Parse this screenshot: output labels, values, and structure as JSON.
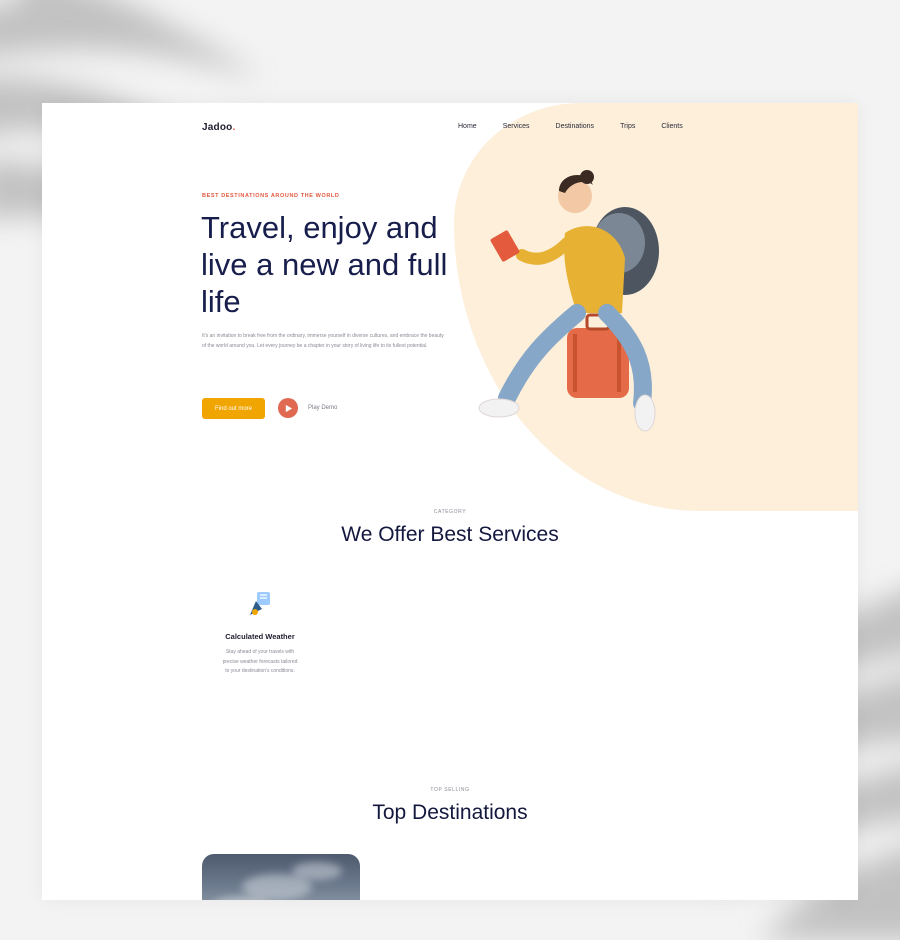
{
  "brand": {
    "name": "Jadoo",
    "suffix": "."
  },
  "nav": {
    "items": [
      "Home",
      "Services",
      "Destinations",
      "Trips",
      "Clients"
    ]
  },
  "hero": {
    "eyebrow": "Best destinations around the world",
    "title": "Travel, enjoy and live a new and full life",
    "description": "It's an invitation to break free from the ordinary, immerse yourself in diverse cultures, and embrace the beauty of the world around you. Let every journey be a chapter in your story of living life to its fullest potential.",
    "cta_label": "Find out more",
    "play_label": "Play Demo"
  },
  "services": {
    "eyebrow": "CATEGORY",
    "title": "We Offer Best Services",
    "items": [
      {
        "title": "Calculated Weather",
        "description": "Stay ahead of your travels with precise weather forecasts tailored to your destination's conditions.",
        "icon": "satellite-dish-icon"
      }
    ]
  },
  "destinations": {
    "eyebrow": "TOP SELLING",
    "title": "Top Destinations"
  },
  "colors": {
    "accent": "#e2583e",
    "button": "#f1a501",
    "blob": "#fdefda",
    "heading": "#181e4b"
  }
}
